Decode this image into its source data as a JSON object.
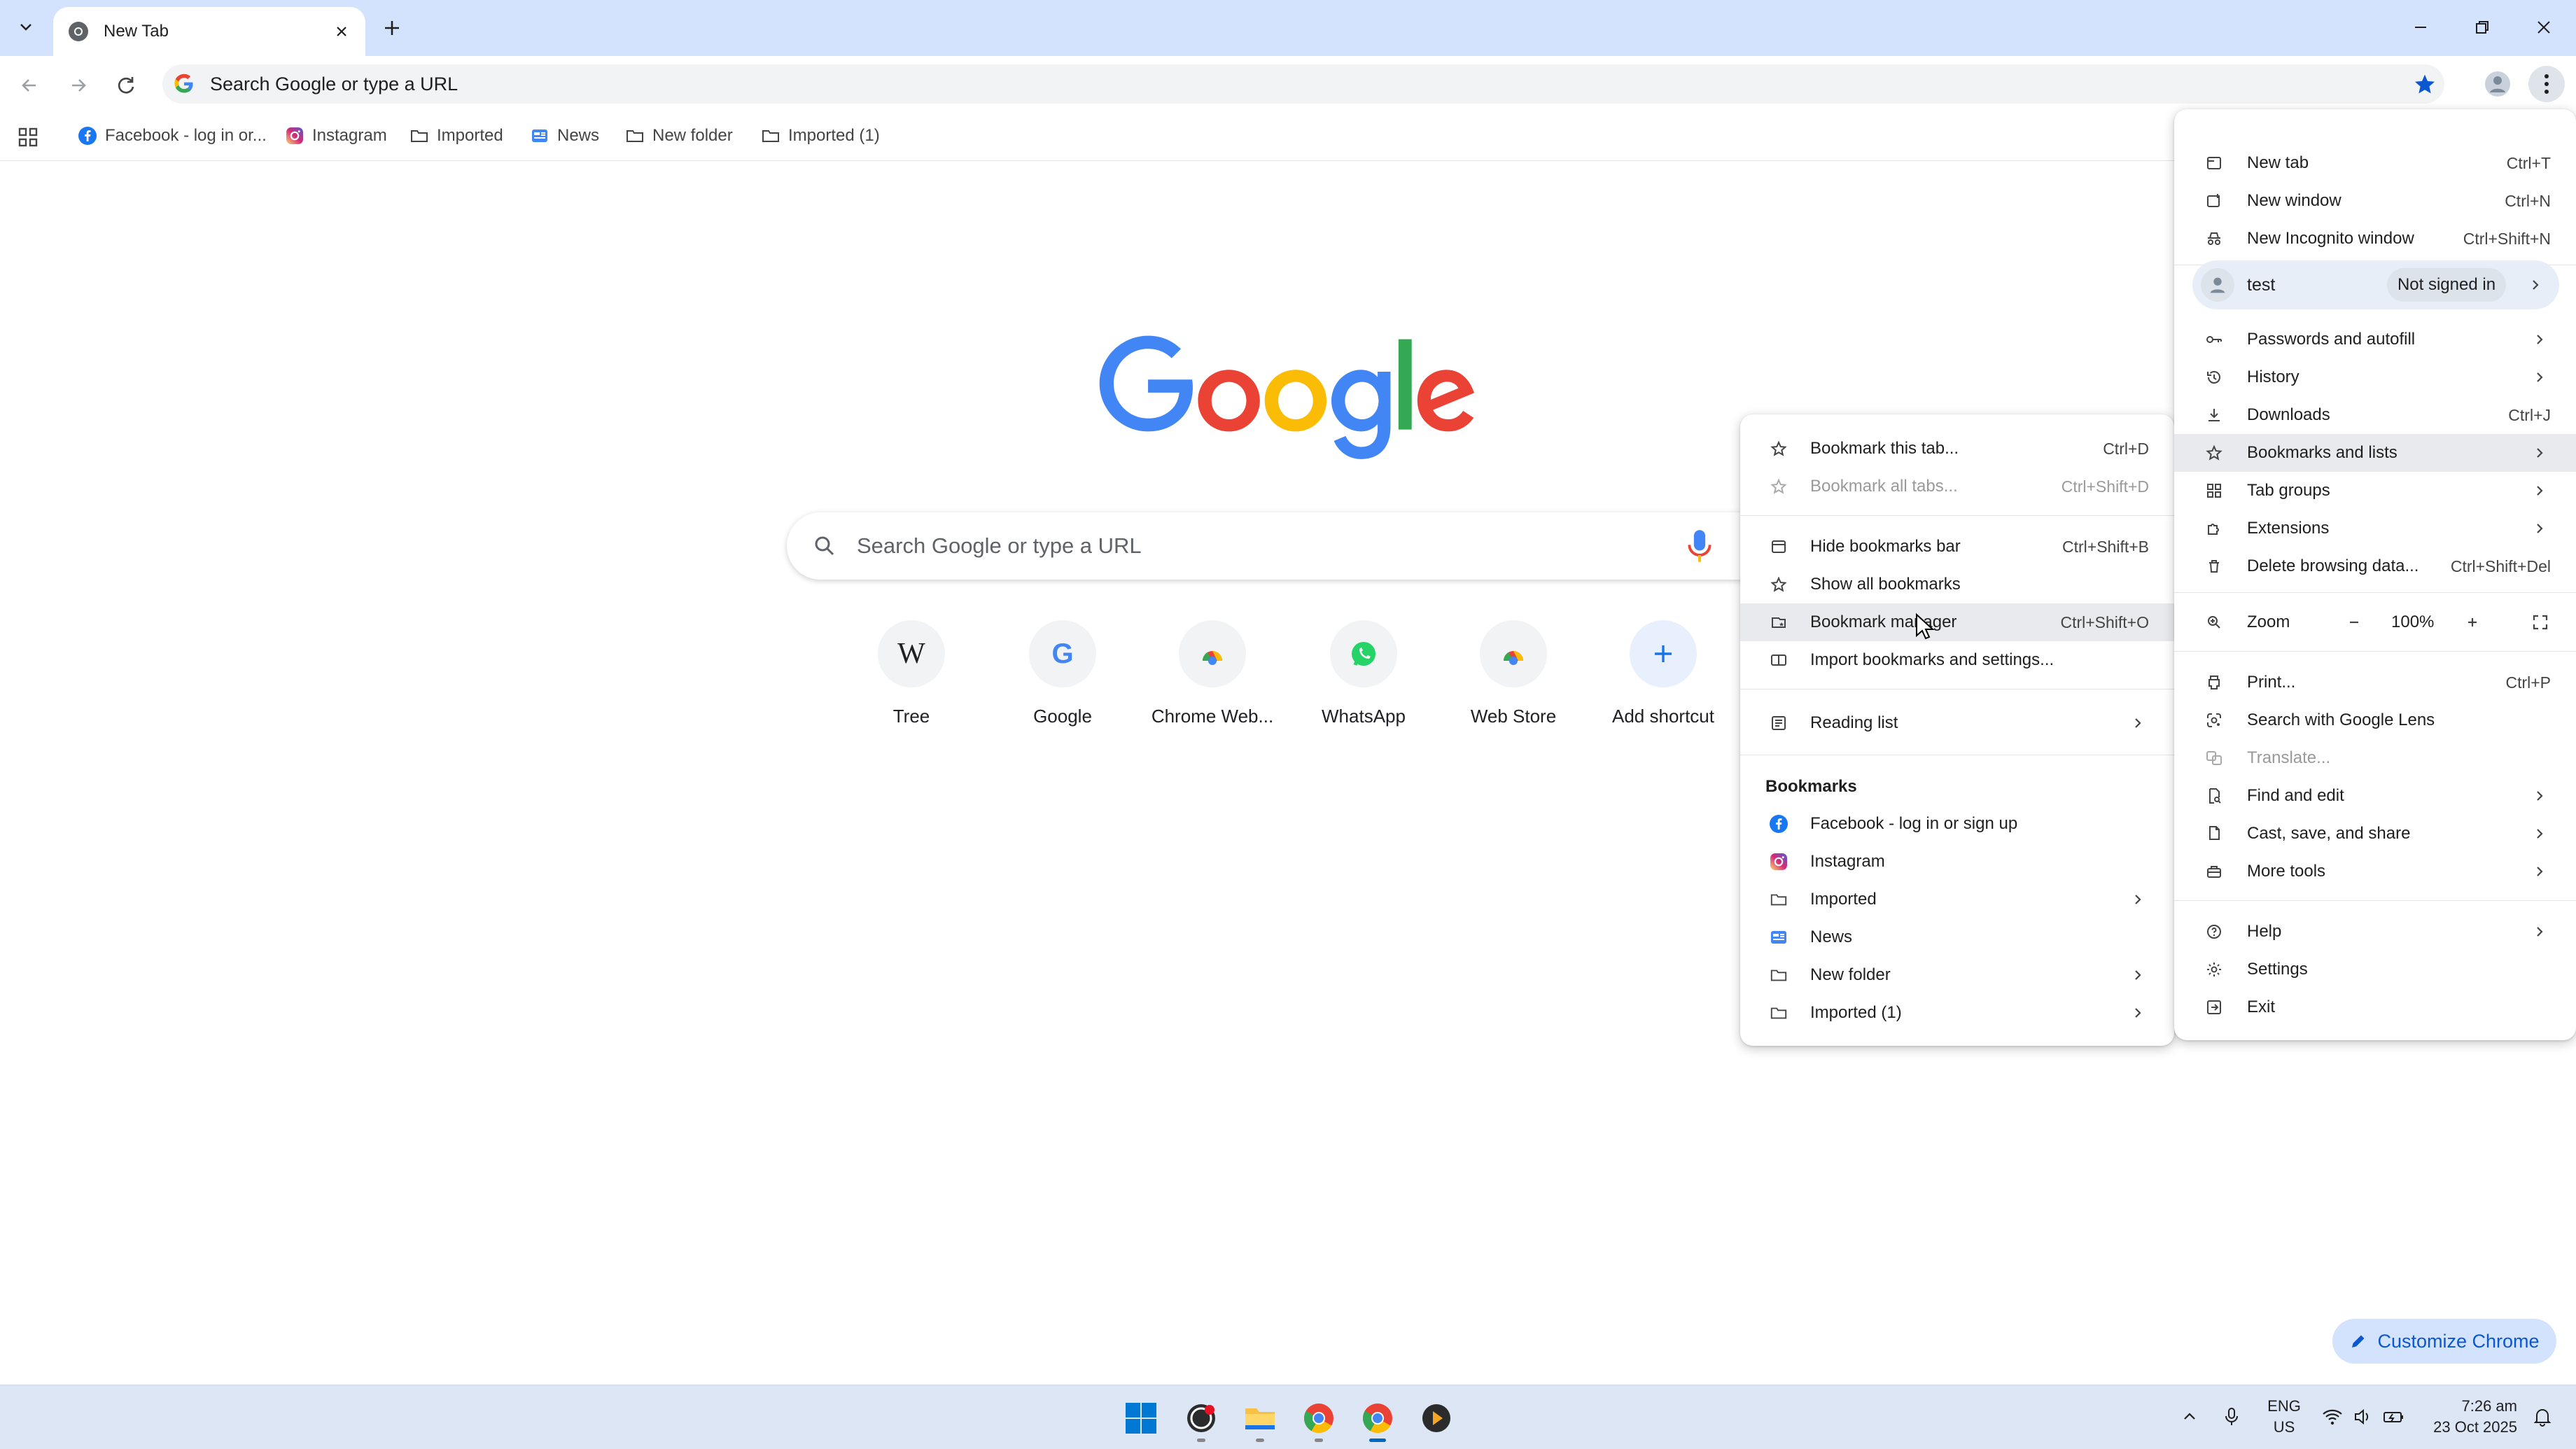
{
  "browser": {
    "tab": {
      "title": "New Tab"
    },
    "omnibox": {
      "placeholder": "Search Google or type a URL"
    }
  },
  "bookmarks_bar": {
    "items": [
      {
        "label": "Facebook - log in or...",
        "icon": "facebook-icon"
      },
      {
        "label": "Instagram",
        "icon": "instagram-icon"
      },
      {
        "label": "Imported",
        "icon": "folder-icon"
      },
      {
        "label": "News",
        "icon": "news-icon"
      },
      {
        "label": "New folder",
        "icon": "folder-icon"
      },
      {
        "label": "Imported (1)",
        "icon": "folder-icon"
      }
    ]
  },
  "ntp": {
    "search_placeholder": "Search Google or type a URL",
    "shortcuts": [
      {
        "label": "Tree"
      },
      {
        "label": "Google"
      },
      {
        "label": "Chrome Web..."
      },
      {
        "label": "WhatsApp"
      },
      {
        "label": "Web Store"
      },
      {
        "label": "Add shortcut"
      }
    ],
    "customize_label": "Customize Chrome"
  },
  "main_menu": {
    "new_tab": {
      "label": "New tab",
      "shortcut": "Ctrl+T"
    },
    "new_window": {
      "label": "New window",
      "shortcut": "Ctrl+N"
    },
    "new_incognito": {
      "label": "New Incognito window",
      "shortcut": "Ctrl+Shift+N"
    },
    "profile": {
      "name": "test",
      "status": "Not signed in"
    },
    "passwords": {
      "label": "Passwords and autofill"
    },
    "history": {
      "label": "History"
    },
    "downloads": {
      "label": "Downloads",
      "shortcut": "Ctrl+J"
    },
    "bookmarks": {
      "label": "Bookmarks and lists"
    },
    "tab_groups": {
      "label": "Tab groups"
    },
    "extensions": {
      "label": "Extensions"
    },
    "delete_data": {
      "label": "Delete browsing data...",
      "shortcut": "Ctrl+Shift+Del"
    },
    "zoom": {
      "label": "Zoom",
      "value": "100%"
    },
    "print": {
      "label": "Print...",
      "shortcut": "Ctrl+P"
    },
    "lens": {
      "label": "Search with Google Lens"
    },
    "translate": {
      "label": "Translate..."
    },
    "find_edit": {
      "label": "Find and edit"
    },
    "cast": {
      "label": "Cast, save, and share"
    },
    "more_tools": {
      "label": "More tools"
    },
    "help": {
      "label": "Help"
    },
    "settings": {
      "label": "Settings"
    },
    "exit": {
      "label": "Exit"
    }
  },
  "bookmarks_submenu": {
    "bookmark_tab": {
      "label": "Bookmark this tab...",
      "shortcut": "Ctrl+D"
    },
    "bookmark_all": {
      "label": "Bookmark all tabs...",
      "shortcut": "Ctrl+Shift+D"
    },
    "hide_bar": {
      "label": "Hide bookmarks bar",
      "shortcut": "Ctrl+Shift+B"
    },
    "show_all": {
      "label": "Show all bookmarks"
    },
    "manager": {
      "label": "Bookmark manager",
      "shortcut": "Ctrl+Shift+O"
    },
    "import": {
      "label": "Import bookmarks and settings..."
    },
    "reading_list": {
      "label": "Reading list"
    },
    "section_header": "Bookmarks",
    "items": [
      {
        "label": "Facebook - log in or sign up"
      },
      {
        "label": "Instagram"
      },
      {
        "label": "Imported"
      },
      {
        "label": "News"
      },
      {
        "label": "New folder"
      },
      {
        "label": "Imported (1)"
      }
    ]
  },
  "taskbar": {
    "language": {
      "line1": "ENG",
      "line2": "US"
    },
    "clock": {
      "time": "7:26 am",
      "date": "23 Oct 2025"
    }
  },
  "colors": {
    "accent": "#0b57d0",
    "titlebar": "#d3e3fd",
    "taskbar": "#dde6f4"
  }
}
